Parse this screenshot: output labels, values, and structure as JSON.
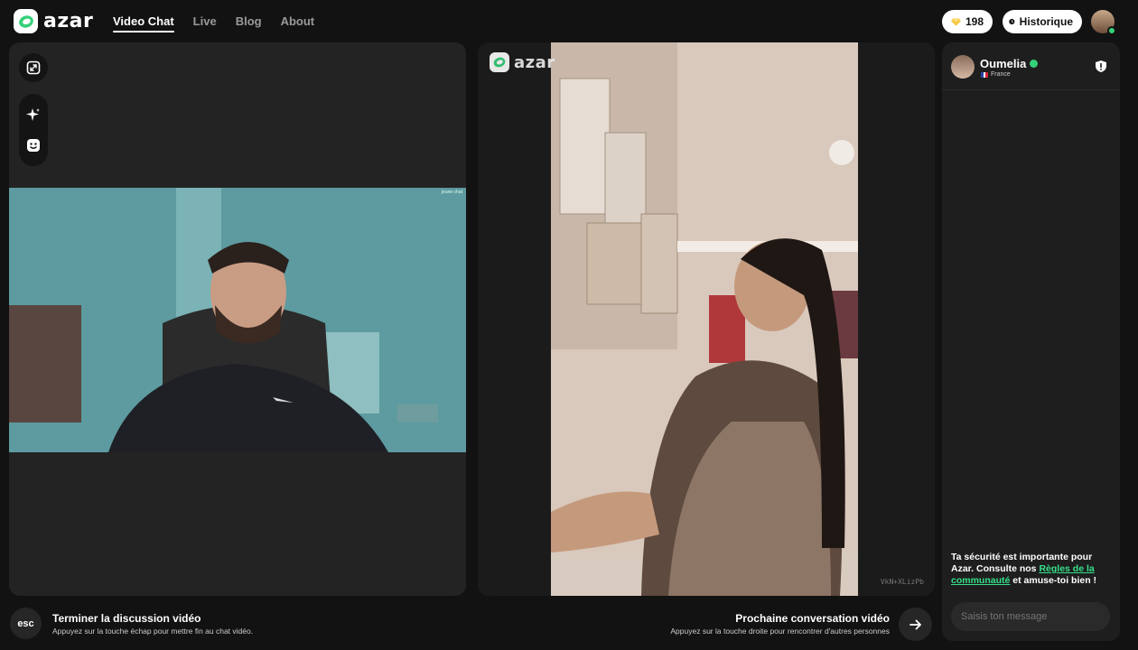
{
  "brand": {
    "name": "azar",
    "accent": "#36d07a"
  },
  "nav": {
    "items": [
      "Video Chat",
      "Live",
      "Blog",
      "About"
    ],
    "active": "Video Chat"
  },
  "header": {
    "gems": "198",
    "history_label": "Historique"
  },
  "local_video": {
    "watermark": "jeune chat"
  },
  "remote_video": {
    "session_id": "VkN+XLizPb"
  },
  "peer": {
    "name": "Oumelia",
    "country": "France"
  },
  "chat": {
    "safety_prefix": "Ta sécurité est importante pour Azar. Consulte nos ",
    "safety_link": "Règles de la communauté",
    "safety_suffix": " et amuse-toi bien !",
    "placeholder": "Saisis ton message"
  },
  "footer": {
    "esc_label": "esc",
    "end_title": "Terminer la discussion vidéo",
    "end_subtitle": "Appuyez sur la touche échap pour mettre fin au chat vidéo.",
    "next_title": "Prochaine conversation vidéo",
    "next_subtitle": "Appuyez sur la touche droite pour rencontrer d'autres personnes"
  }
}
